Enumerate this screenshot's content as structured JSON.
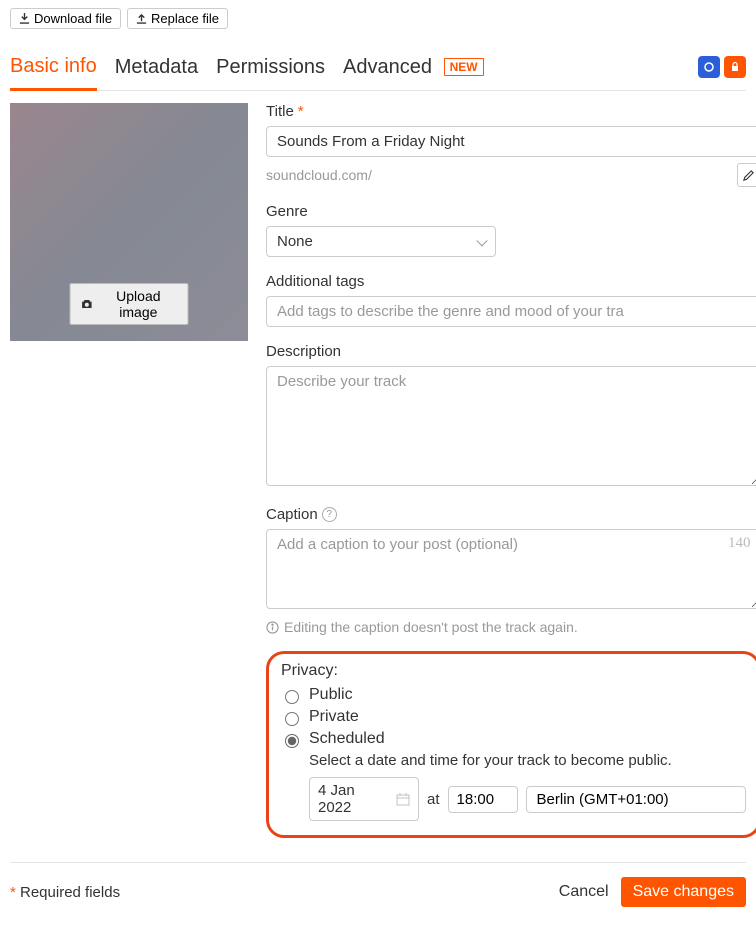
{
  "topButtons": {
    "download": "Download file",
    "replace": "Replace file"
  },
  "tabs": {
    "basic": "Basic info",
    "metadata": "Metadata",
    "permissions": "Permissions",
    "advanced": "Advanced",
    "newBadge": "NEW"
  },
  "artwork": {
    "uploadLabel": "Upload image"
  },
  "title": {
    "label": "Title",
    "value": "Sounds From a Friday Night",
    "urlPrefix": "soundcloud.com/"
  },
  "genre": {
    "label": "Genre",
    "value": "None"
  },
  "tags": {
    "label": "Additional tags",
    "placeholder": "Add tags to describe the genre and mood of your tra"
  },
  "description": {
    "label": "Description",
    "placeholder": "Describe your track"
  },
  "caption": {
    "label": "Caption",
    "placeholder": "Add a caption to your post (optional)",
    "remaining": "140",
    "hint": "Editing the caption doesn't post the track again."
  },
  "privacy": {
    "label": "Privacy:",
    "public": "Public",
    "private": "Private",
    "scheduled": "Scheduled",
    "scheduledDesc": "Select a date and time for your track to become public.",
    "date": "4 Jan 2022",
    "at": "at",
    "time": "18:00",
    "tz": "Berlin (GMT+01:00)"
  },
  "footer": {
    "requiredStar": "*",
    "requiredText": " Required fields",
    "cancel": "Cancel",
    "save": "Save changes"
  }
}
